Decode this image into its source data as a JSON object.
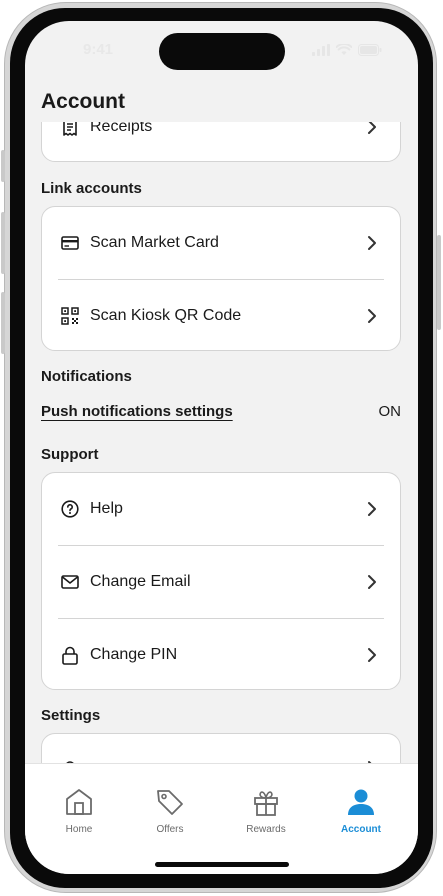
{
  "status_bar": {
    "time": "9:41"
  },
  "header": {
    "title": "Account"
  },
  "top_card": {
    "receipts_label": "Receipts"
  },
  "link_accounts": {
    "title": "Link accounts",
    "items": [
      {
        "label": "Scan Market Card",
        "icon": "card-icon"
      },
      {
        "label": "Scan Kiosk QR Code",
        "icon": "qr-code-icon"
      }
    ]
  },
  "notifications": {
    "title": "Notifications",
    "push_label": "Push notifications settings",
    "push_state": "ON"
  },
  "support": {
    "title": "Support",
    "items": [
      {
        "label": "Help",
        "icon": "help-icon"
      },
      {
        "label": "Change Email",
        "icon": "envelope-icon"
      },
      {
        "label": "Change PIN",
        "icon": "lock-icon"
      }
    ]
  },
  "settings": {
    "title": "Settings"
  },
  "tab_bar": {
    "active_color": "#1b8dd6",
    "tabs": [
      {
        "label": "Home",
        "icon": "home-icon"
      },
      {
        "label": "Offers",
        "icon": "tag-icon"
      },
      {
        "label": "Rewards",
        "icon": "gift-icon"
      },
      {
        "label": "Account",
        "icon": "person-icon",
        "active": true
      }
    ]
  }
}
